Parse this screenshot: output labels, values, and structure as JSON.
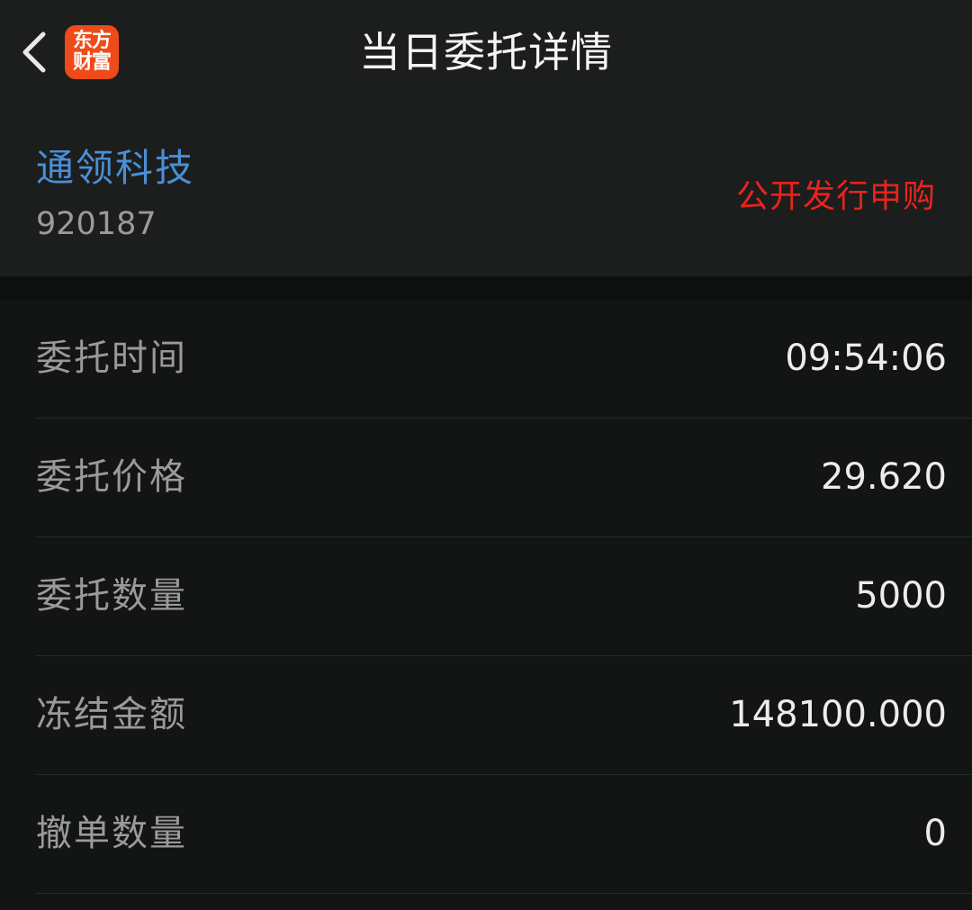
{
  "header": {
    "title": "当日委托详情",
    "back_icon": "chevron-left-icon",
    "logo_line1": "东方",
    "logo_line2": "财富",
    "logo_color": "#ee4a1a"
  },
  "stock": {
    "name": "通领科技",
    "code": "920187",
    "order_type": "公开发行申购",
    "name_color": "#4a8fd6",
    "order_type_color": "#e9231c"
  },
  "details": [
    {
      "label": "委托时间",
      "value": "09:54:06"
    },
    {
      "label": "委托价格",
      "value": "29.620"
    },
    {
      "label": "委托数量",
      "value": "5000"
    },
    {
      "label": "冻结金额",
      "value": "148100.000"
    },
    {
      "label": "撤单数量",
      "value": "0"
    }
  ]
}
